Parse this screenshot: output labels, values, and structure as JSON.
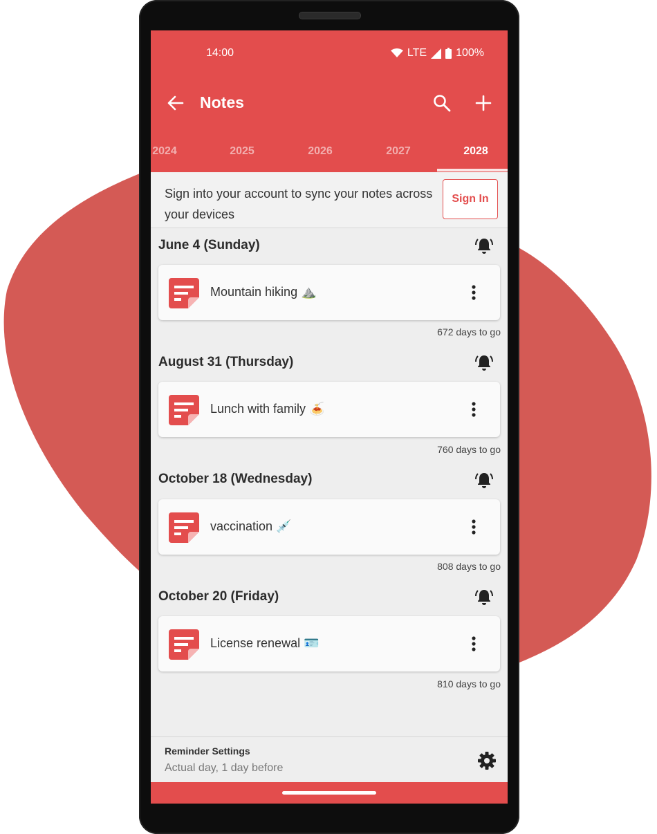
{
  "colors": {
    "accent": "#e34d4d",
    "blob": "#d45a55",
    "background": "#eeeeee"
  },
  "status_bar": {
    "time": "14:00",
    "network": "LTE",
    "battery": "100%"
  },
  "app_bar": {
    "title": "Notes",
    "icons": [
      "back-arrow-icon",
      "search-icon",
      "plus-icon"
    ]
  },
  "tabs": [
    {
      "label": "2024",
      "active": false
    },
    {
      "label": "2025",
      "active": false
    },
    {
      "label": "2026",
      "active": false
    },
    {
      "label": "2027",
      "active": false
    },
    {
      "label": "2028",
      "active": true
    }
  ],
  "signin": {
    "message": "Sign into your account to sync your notes across your devices",
    "button": "Sign In"
  },
  "notes": [
    {
      "date": "June 4 (Sunday)",
      "title": "Mountain hiking ⛰️",
      "countdown": "672 days to go"
    },
    {
      "date": "August 31 (Thursday)",
      "title": "Lunch with family 🍝",
      "countdown": "760 days to go"
    },
    {
      "date": "October 18 (Wednesday)",
      "title": "vaccination 💉",
      "countdown": "808 days to go"
    },
    {
      "date": "October 20 (Friday)",
      "title": "License renewal 🪪",
      "countdown": "810 days to go"
    }
  ],
  "reminder": {
    "title": "Reminder Settings",
    "subtitle": "Actual day, 1 day before"
  }
}
